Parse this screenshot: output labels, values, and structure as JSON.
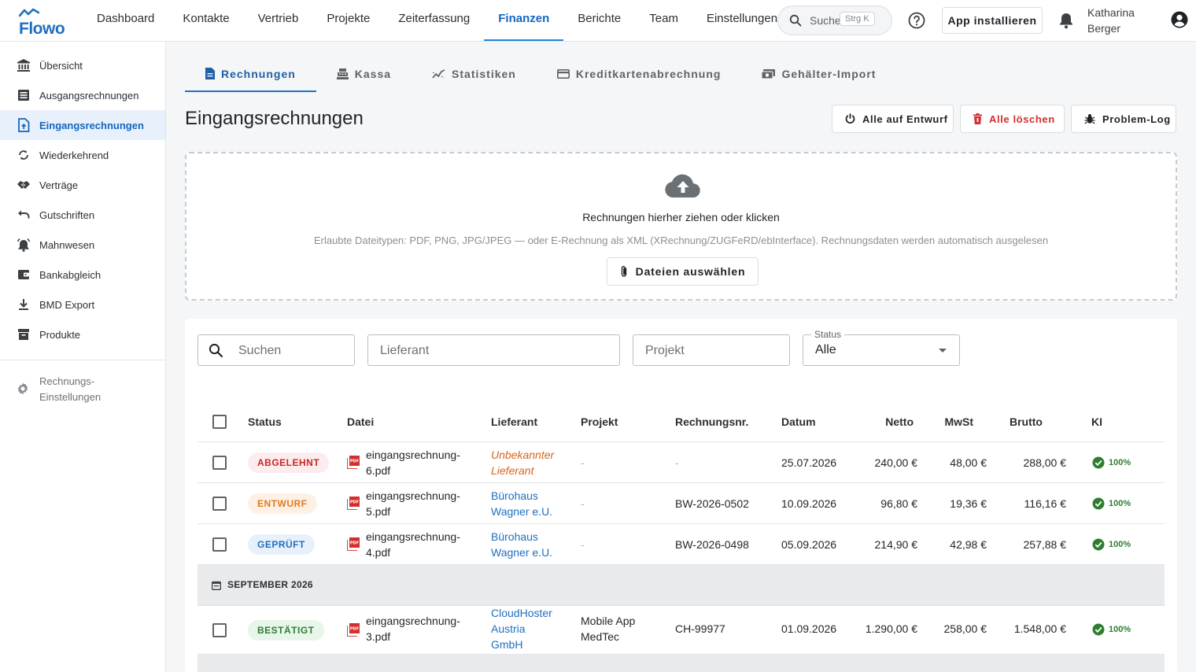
{
  "app": {
    "logo_text": "Flowo"
  },
  "topnav": {
    "items": [
      "Dashboard",
      "Kontakte",
      "Vertrieb",
      "Projekte",
      "Zeiterfassung",
      "Finanzen",
      "Berichte",
      "Team",
      "Einstellungen"
    ],
    "active": "Finanzen"
  },
  "global_search": {
    "label": "Suchen",
    "shortcut": "Strg K"
  },
  "install_label": "App installieren",
  "user": {
    "first_name": "Katharina",
    "last_name": "Berger"
  },
  "sidebar": {
    "items": [
      {
        "label": "Übersicht",
        "icon": "bank-icon"
      },
      {
        "label": "Ausgangsrechnungen",
        "icon": "list-icon"
      },
      {
        "label": "Eingangsrechnungen",
        "icon": "file-upload-icon"
      },
      {
        "label": "Wiederkehrend",
        "icon": "sync-icon"
      },
      {
        "label": "Verträge",
        "icon": "handshake-icon"
      },
      {
        "label": "Gutschriften",
        "icon": "undo-icon"
      },
      {
        "label": "Mahnwesen",
        "icon": "alarm-bell-icon"
      },
      {
        "label": "Bankabgleich",
        "icon": "wallet-icon"
      },
      {
        "label": "BMD Export",
        "icon": "download-icon"
      },
      {
        "label": "Produkte",
        "icon": "box-icon"
      }
    ],
    "active": "Eingangsrechnungen",
    "settings": {
      "line1": "Rechnungs-",
      "line2": "Einstellungen",
      "icon": "gear-icon"
    }
  },
  "subtabs": {
    "items": [
      {
        "label": "Rechnungen",
        "icon": "document-icon"
      },
      {
        "label": "Kassa",
        "icon": "cash-register-icon"
      },
      {
        "label": "Statistiken",
        "icon": "trend-icon"
      },
      {
        "label": "Kreditkartenabrechnung",
        "icon": "credit-card-icon"
      },
      {
        "label": "Gehälter-Import",
        "icon": "money-icon"
      }
    ],
    "active": "Rechnungen"
  },
  "page_title": "Eingangsrechnungen",
  "actions": {
    "draft_all": "Alle auf Entwurf",
    "delete_all": "Alle löschen",
    "problem_log": "Problem-Log"
  },
  "dropzone": {
    "title": "Rechnungen hierher ziehen oder klicken",
    "hint": "Erlaubte Dateitypen: PDF, PNG, JPG/JPEG — oder E-Rechnung als XML (XRechnung/ZUGFeRD/ebInterface). Rechnungsdaten werden automatisch ausgelesen",
    "button": "Dateien auswählen"
  },
  "filters": {
    "search_placeholder": "Suchen",
    "supplier_placeholder": "Lieferant",
    "project_placeholder": "Projekt",
    "status_label": "Status",
    "status_value": "Alle"
  },
  "table": {
    "headers": {
      "status": "Status",
      "file": "Datei",
      "supplier": "Lieferant",
      "project": "Projekt",
      "invoice_no": "Rechnungsnr.",
      "date": "Datum",
      "net": "Netto",
      "vat": "MwSt",
      "gross": "Brutto",
      "ai": "KI"
    },
    "rows": [
      {
        "status": "ABGELEHNT",
        "status_kind": "rejected",
        "file_1": "eingangsrechnung-",
        "file_2": "6.pdf",
        "supplier_1": "Unbekannter",
        "supplier_2": "Lieferant",
        "supplier_3": "",
        "project_1": "-",
        "project_2": "",
        "invoice_no": "-",
        "date": "25.07.2026",
        "net": "240,00 €",
        "vat": "48,00 €",
        "gross": "288,00 €",
        "ai": "100%"
      },
      {
        "status": "ENTWURF",
        "status_kind": "draft",
        "file_1": "eingangsrechnung-",
        "file_2": "5.pdf",
        "supplier_1": "Bürohaus",
        "supplier_2": "Wagner e.U.",
        "supplier_3": "",
        "project_1": "-",
        "project_2": "",
        "invoice_no": "BW-2026-0502",
        "date": "10.09.2026",
        "net": "96,80 €",
        "vat": "19,36 €",
        "gross": "116,16 €",
        "ai": "100%"
      },
      {
        "status": "GEPRÜFT",
        "status_kind": "checked",
        "file_1": "eingangsrechnung-",
        "file_2": "4.pdf",
        "supplier_1": "Bürohaus",
        "supplier_2": "Wagner e.U.",
        "supplier_3": "",
        "project_1": "-",
        "project_2": "",
        "invoice_no": "BW-2026-0498",
        "date": "05.09.2026",
        "net": "214,90 €",
        "vat": "42,98 €",
        "gross": "257,88 €",
        "ai": "100%"
      }
    ],
    "group": {
      "label": "SEPTEMBER 2026"
    },
    "group_rows": [
      {
        "status": "BESTÄTIGT",
        "status_kind": "confirmed",
        "file_1": "eingangsrechnung-",
        "file_2": "3.pdf",
        "supplier_1": "CloudHoster",
        "supplier_2": "Austria",
        "supplier_3": "GmbH",
        "project_1": "Mobile App",
        "project_2": "MedTec",
        "invoice_no": "CH-99977",
        "date": "01.09.2026",
        "net": "1.290,00 €",
        "vat": "258,00 €",
        "gross": "1.548,00 €",
        "ai": "100%"
      }
    ]
  },
  "colors": {
    "brand": "#1f6fc0",
    "accent": "#1e88e5",
    "danger": "#d32f2f",
    "success": "#2e7d32",
    "warning": "#e07b20"
  }
}
